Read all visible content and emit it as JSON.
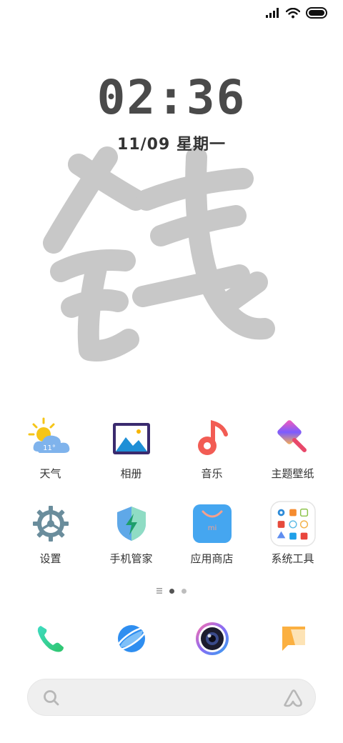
{
  "status_bar": {
    "signal_icon": "signal-bars-icon",
    "wifi_icon": "wifi-icon",
    "battery_icon": "battery-icon"
  },
  "lockscreen": {
    "time": "02:36",
    "date": "11/09 星期一",
    "wallpaper_char": "钱"
  },
  "apps": [
    {
      "label": "天气",
      "icon": "weather-icon",
      "temp": "11°"
    },
    {
      "label": "相册",
      "icon": "gallery-icon"
    },
    {
      "label": "音乐",
      "icon": "music-icon"
    },
    {
      "label": "主题壁纸",
      "icon": "themes-icon"
    },
    {
      "label": "设置",
      "icon": "settings-icon"
    },
    {
      "label": "手机管家",
      "icon": "security-icon"
    },
    {
      "label": "应用商店",
      "icon": "app-store-icon",
      "badge": "mi"
    },
    {
      "label": "系统工具",
      "icon": "system-tools-folder-icon"
    }
  ],
  "page_indicator": {
    "pages": 2,
    "active": 0
  },
  "dock": [
    {
      "name": "phone",
      "icon": "phone-icon"
    },
    {
      "name": "browser",
      "icon": "browser-icon"
    },
    {
      "name": "camera",
      "icon": "camera-icon"
    },
    {
      "name": "messages",
      "icon": "messages-icon"
    }
  ],
  "search": {
    "search_icon": "search-icon",
    "assistant_icon": "assistant-icon"
  },
  "colors": {
    "clock": "#4a4a4a",
    "glyph": "#c8c8c8",
    "appstore": "#45a6f0",
    "settings": "#6a8d9c"
  }
}
